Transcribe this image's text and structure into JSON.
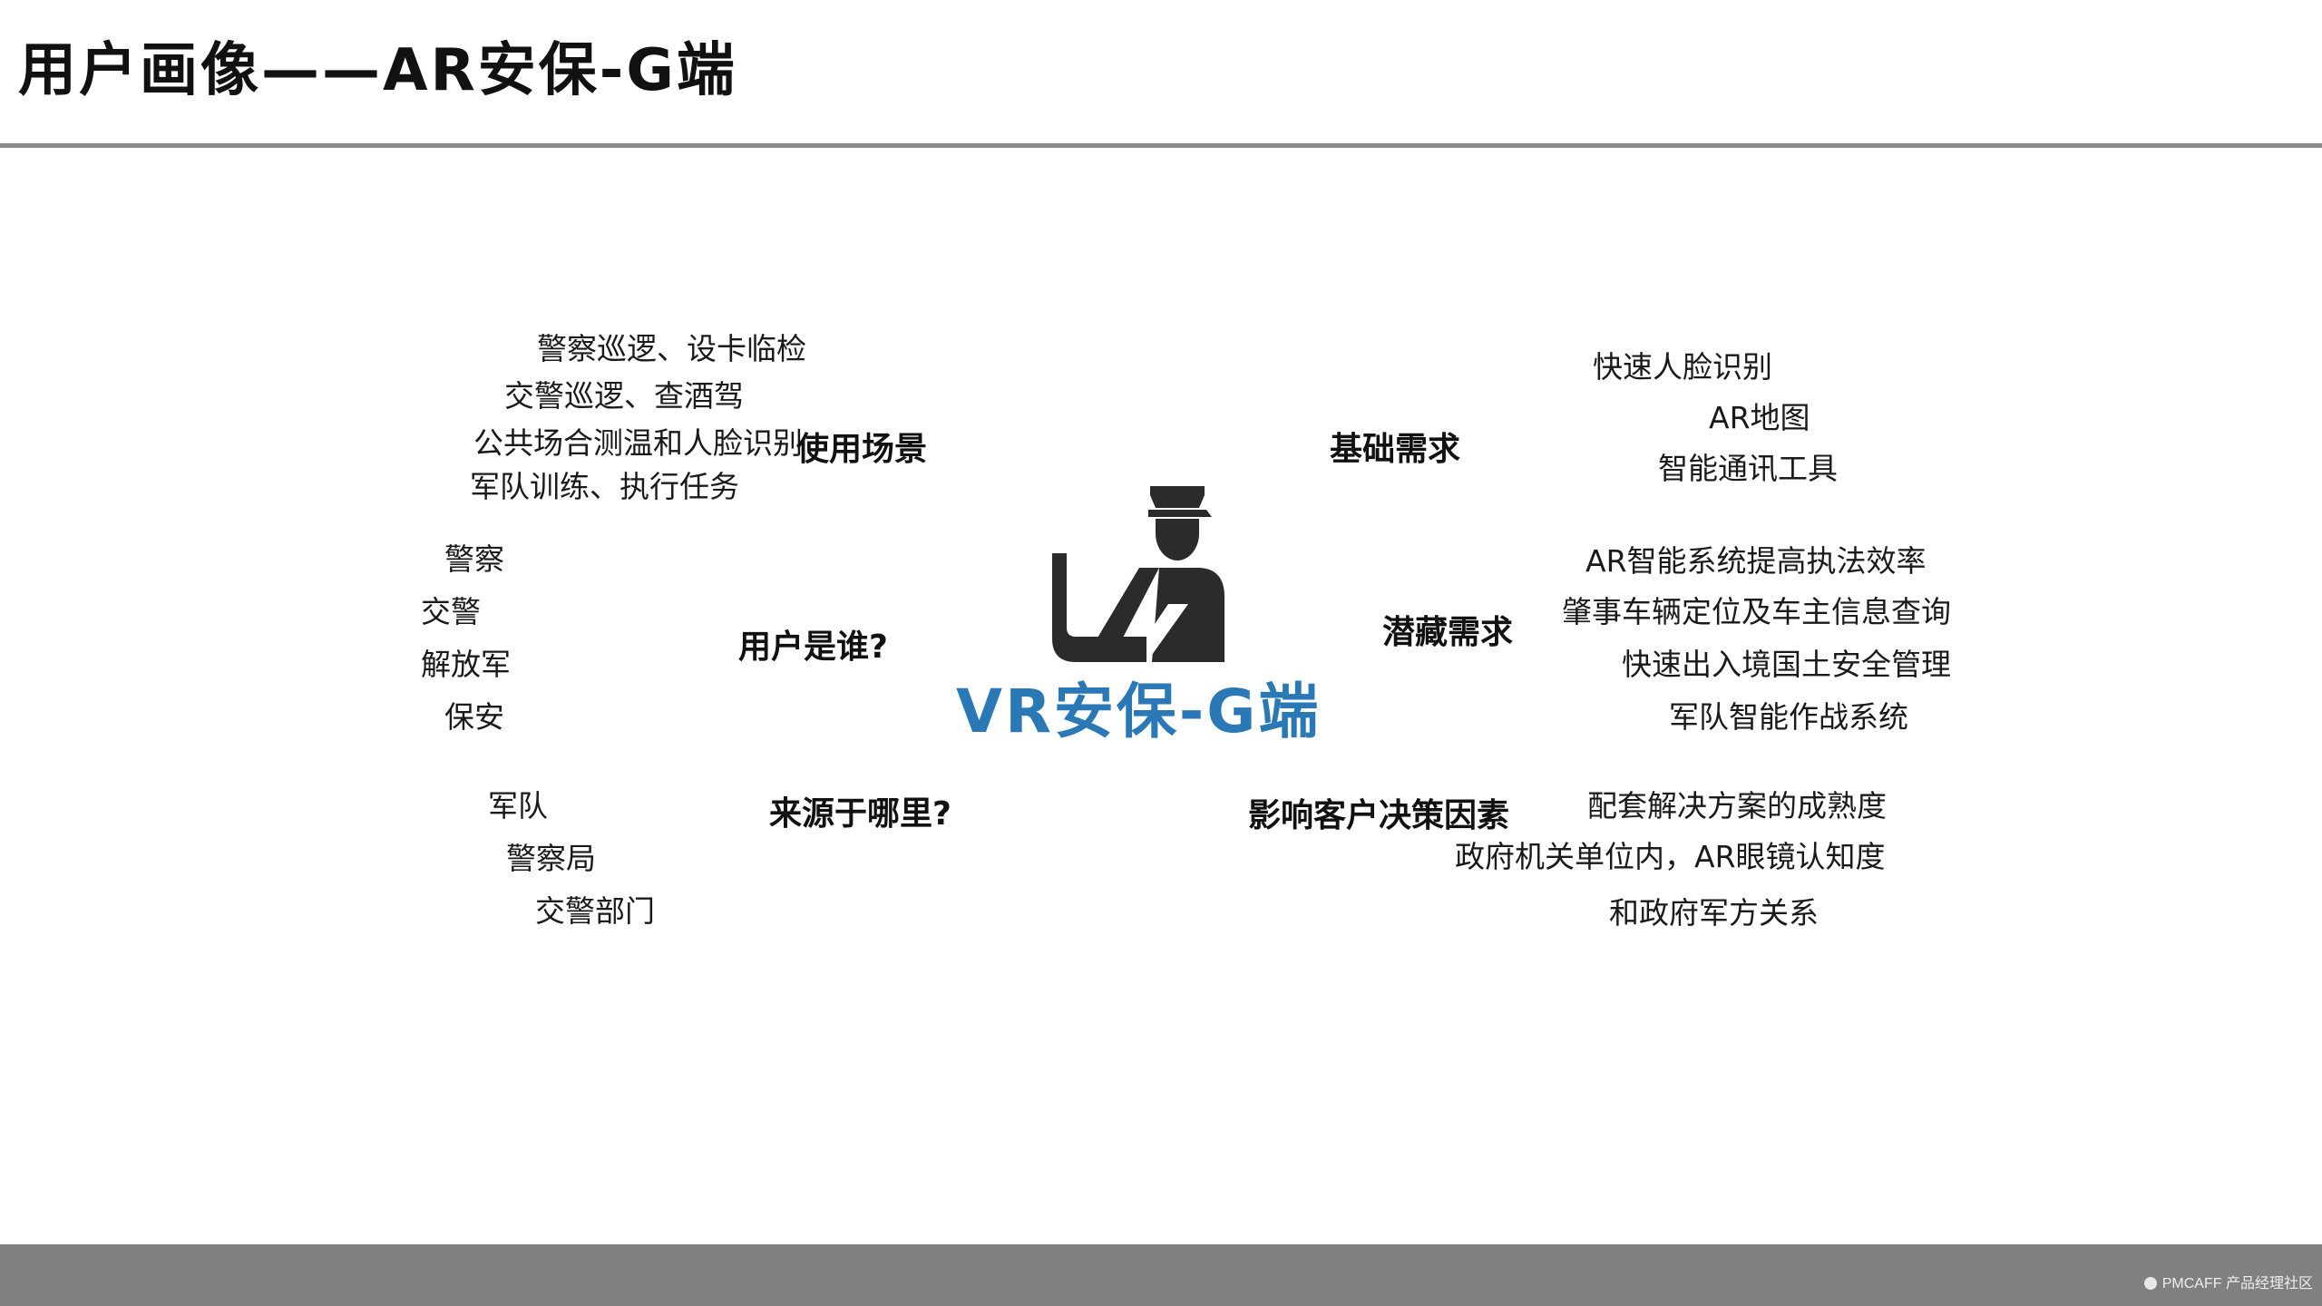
{
  "title": "用户画像——AR安保-G端",
  "center": {
    "label": "VR安保-G端",
    "icon": "police-officer-icon"
  },
  "categories": {
    "scenarios": "使用场景",
    "basic_needs": "基础需求",
    "who": "用户是谁?",
    "hidden_needs": "潜藏需求",
    "source": "来源于哪里?",
    "factors": "影响客户决策因素"
  },
  "scenarios": [
    "警察巡逻、设卡临检",
    "交警巡逻、查酒驾",
    "公共场合测温和人脸识别",
    "军队训练、执行任务"
  ],
  "basic_needs": [
    "快速人脸识别",
    "AR地图",
    "智能通讯工具"
  ],
  "who": [
    "警察",
    "交警",
    "解放军",
    "保安"
  ],
  "hidden_needs": [
    "AR智能系统提高执法效率",
    "肇事车辆定位及车主信息查询",
    "快速出入境国土安全管理",
    "军队智能作战系统"
  ],
  "source": [
    "军队",
    "警察局",
    "交警部门"
  ],
  "factors": [
    "配套解决方案的成熟度",
    "政府机关单位内，AR眼镜认知度",
    "和政府军方关系"
  ],
  "footer": {
    "brand": "PMCAFF",
    "tagline": "产品经理社区"
  },
  "colors": {
    "accent": "#2a78b5",
    "rule": "#8c8c8c",
    "footer": "#808080"
  }
}
